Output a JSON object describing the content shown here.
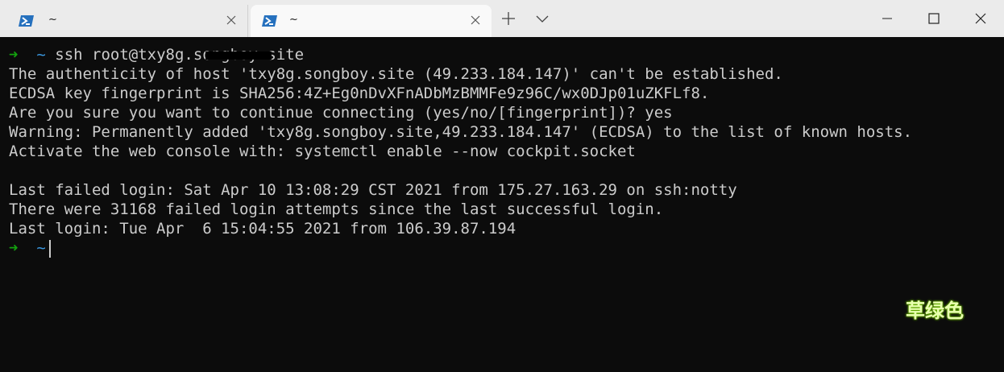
{
  "tabs": [
    {
      "title": "~",
      "active": false
    },
    {
      "title": "~",
      "active": true
    }
  ],
  "titlebar_buttons": {
    "new_tab": "+",
    "dropdown": "⌄"
  },
  "window_controls": [
    "minimize",
    "maximize",
    "close"
  ],
  "terminal": {
    "prompt_arrow": "➜",
    "prompt_dir": "~",
    "command": "ssh root@txy8g.songboy.site",
    "output": [
      "The authenticity of host 'txy8g.songboy.site (49.233.184.147)' can't be established.",
      "ECDSA key fingerprint is SHA256:4Z+Eg0nDvXFnADbMzBMMFe9z96C/wx0DJp01uZKFLf8.",
      "Are you sure you want to continue connecting (yes/no/[fingerprint])? yes",
      "Warning: Permanently added 'txy8g.songboy.site,49.233.184.147' (ECDSA) to the list of known hosts.",
      "Activate the web console with: systemctl enable --now cockpit.socket",
      "",
      "Last failed login: Sat Apr 10 13:08:29 CST 2021 from 175.27.163.29 on ssh:notty",
      "There were 31168 failed login attempts since the last successful login.",
      "Last login: Tue Apr  6 15:04:55 2021 from 106.39.87.194"
    ]
  },
  "watermark": "草绿色",
  "colors": {
    "terminal_bg": "#0c0c0c",
    "terminal_fg": "#cccccc",
    "prompt_arrow": "#13a10e",
    "prompt_dir": "#3a96dd",
    "titlebar_bg": "#ebebeb",
    "active_tab_bg": "#f9f9f9"
  }
}
